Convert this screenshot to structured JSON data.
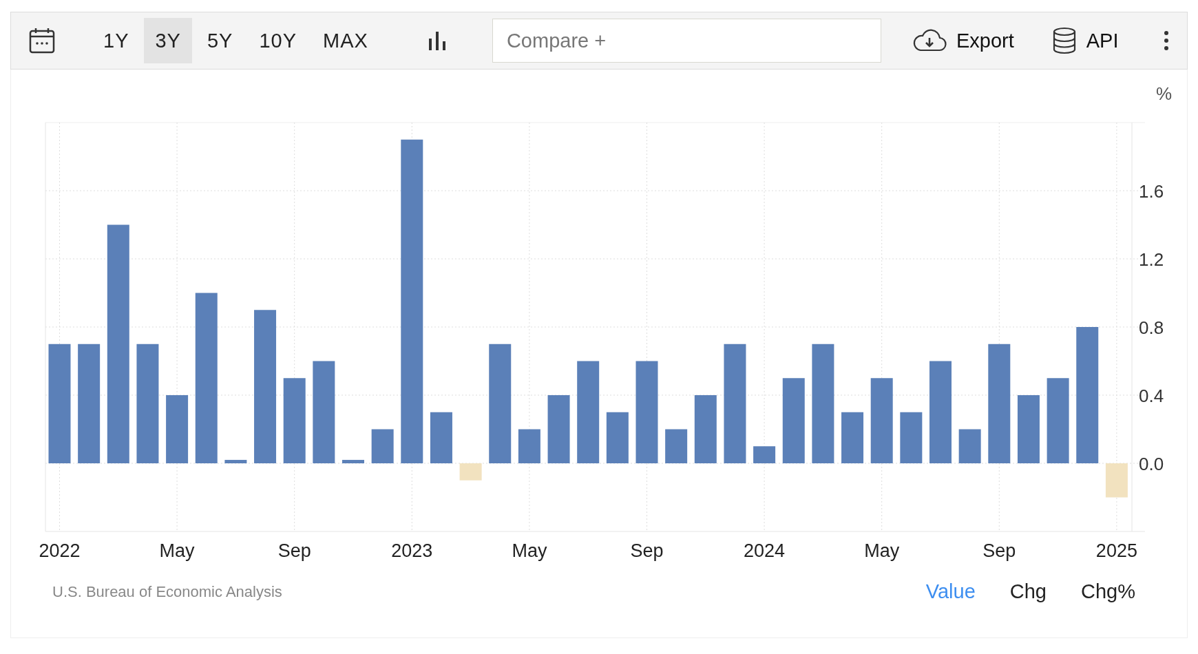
{
  "toolbar": {
    "ranges": [
      {
        "label": "1Y",
        "selected": false
      },
      {
        "label": "3Y",
        "selected": true
      },
      {
        "label": "5Y",
        "selected": false
      },
      {
        "label": "10Y",
        "selected": false
      },
      {
        "label": "MAX",
        "selected": false
      }
    ],
    "compare": {
      "placeholder": "Compare +"
    },
    "export": "Export",
    "api": "API"
  },
  "chart": {
    "unit": "%",
    "chart_data": {
      "type": "bar",
      "grid": true,
      "categories": [
        "2022",
        null,
        null,
        null,
        "May",
        null,
        null,
        null,
        "Sep",
        null,
        null,
        null,
        "2023",
        null,
        null,
        null,
        "May",
        null,
        null,
        null,
        "Sep",
        null,
        null,
        null,
        "2024",
        null,
        null,
        null,
        "May",
        null,
        null,
        null,
        "Sep",
        null,
        null,
        null,
        "2025"
      ],
      "series": [
        {
          "color": "#5b80b8",
          "values": [
            0.7,
            0.7,
            1.4,
            0.7,
            0.4,
            1.0,
            0.02,
            0.9,
            0.5,
            0.6,
            0.02,
            0.2,
            1.9,
            0.3,
            null,
            0.7,
            0.2,
            0.4,
            0.6,
            0.3,
            0.6,
            0.2,
            0.4,
            0.7,
            0.1,
            0.5,
            0.7,
            0.3,
            0.5,
            0.3,
            0.6,
            0.2,
            0.7,
            0.4,
            0.5,
            0.8,
            null
          ]
        },
        {
          "color": "#f2e2bf",
          "values": [
            null,
            null,
            null,
            null,
            null,
            null,
            null,
            null,
            null,
            null,
            null,
            null,
            null,
            null,
            -0.1,
            null,
            null,
            null,
            null,
            null,
            null,
            null,
            null,
            null,
            null,
            null,
            null,
            null,
            null,
            null,
            null,
            null,
            null,
            null,
            null,
            null,
            -0.2
          ]
        }
      ],
      "ylim": [
        -0.4,
        2.0
      ],
      "yticks": [
        {
          "value": 0,
          "label": "0.0"
        },
        0.4,
        0.8,
        1.2,
        1.6
      ]
    }
  },
  "footer": {
    "source": "U.S. Bureau of Economic Analysis",
    "modes": [
      {
        "label": "Value",
        "selected": true
      },
      {
        "label": "Chg",
        "selected": false
      },
      {
        "label": "Chg%",
        "selected": false
      }
    ]
  }
}
